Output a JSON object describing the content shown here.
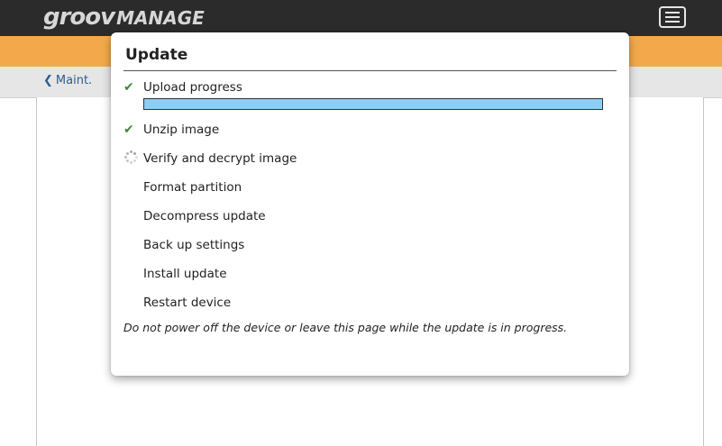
{
  "app": {
    "logo_groov": "groov",
    "logo_manage": "MANAGE"
  },
  "breadcrumb": {
    "back_label": "Maint."
  },
  "modal": {
    "title": "Update",
    "progress_fraction": 1.0,
    "steps": [
      {
        "label": "Upload progress",
        "status": "done"
      },
      {
        "label": "Unzip image",
        "status": "done"
      },
      {
        "label": "Verify and decrypt image",
        "status": "in-progress"
      },
      {
        "label": "Format partition",
        "status": "pending"
      },
      {
        "label": "Decompress update",
        "status": "pending"
      },
      {
        "label": "Back up settings",
        "status": "pending"
      },
      {
        "label": "Install update",
        "status": "pending"
      },
      {
        "label": "Restart device",
        "status": "pending"
      }
    ],
    "note": "Do not power off the device or leave this page while the update is in progress."
  },
  "colors": {
    "header_bg": "#2b2b2b",
    "accent_orange": "#f3a94b",
    "check_green": "#3e8a3a",
    "progress_fill": "#8ecdf5"
  },
  "icons": {
    "done": "check-icon",
    "in_progress": "spinner-icon",
    "menu": "hamburger-menu-icon",
    "back": "chevron-left-icon"
  }
}
